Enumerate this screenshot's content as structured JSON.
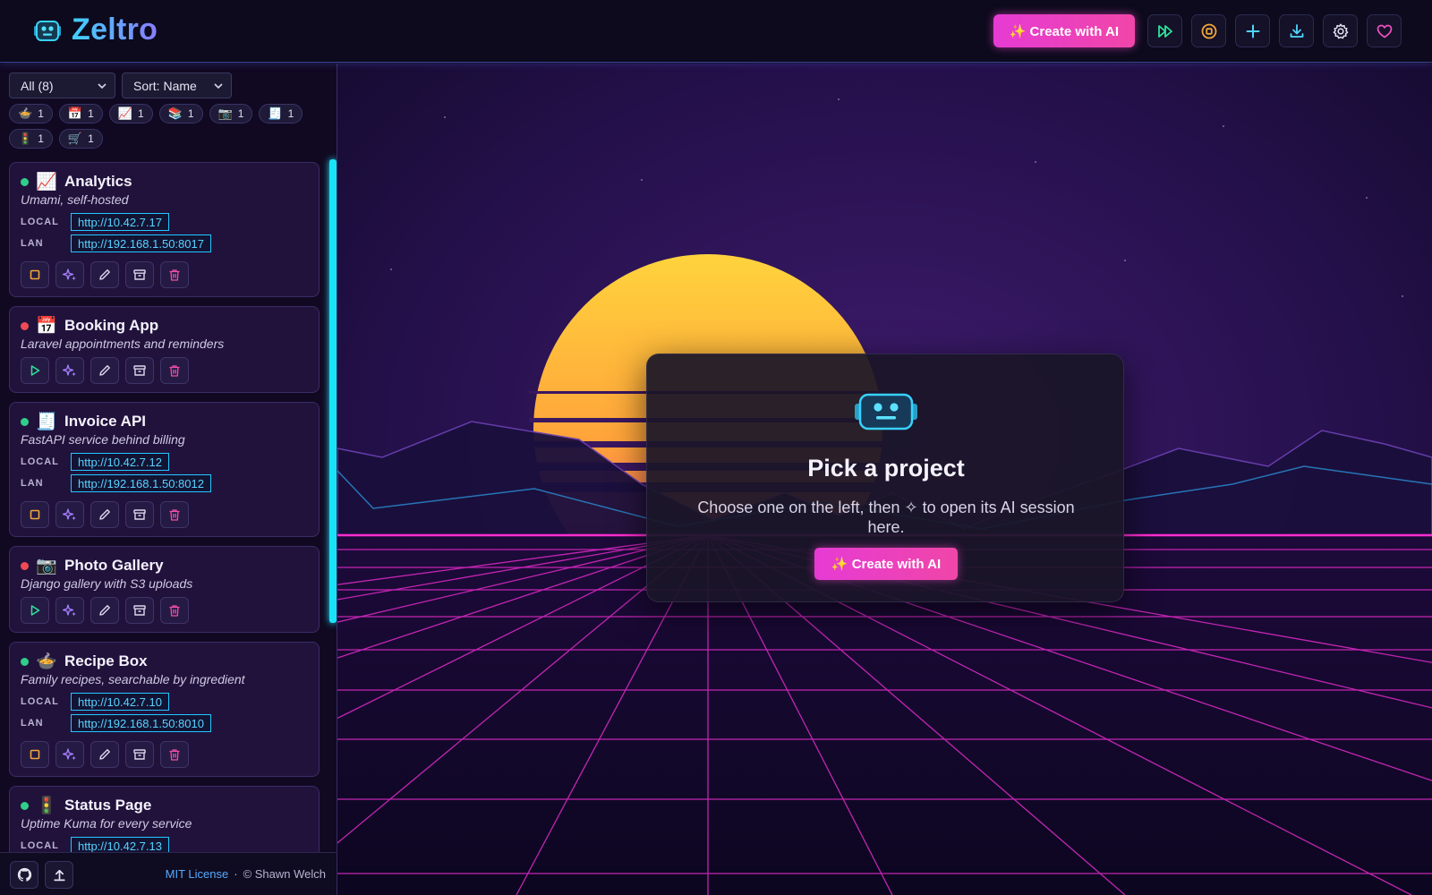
{
  "app": {
    "name": "Zeltro"
  },
  "header": {
    "create_label": "✨ Create with AI",
    "icons": [
      "fast-forward-icon",
      "stop-circle-icon",
      "plus-icon",
      "download-icon",
      "gear-icon",
      "heart-icon"
    ]
  },
  "sidebar": {
    "filter_value": "All (8)",
    "sort_value": "Sort: Name",
    "chips": [
      {
        "emoji": "🍲",
        "count": "1"
      },
      {
        "emoji": "📅",
        "count": "1"
      },
      {
        "emoji": "📈",
        "count": "1"
      },
      {
        "emoji": "📚",
        "count": "1"
      },
      {
        "emoji": "📷",
        "count": "1"
      },
      {
        "emoji": "🧾",
        "count": "1"
      },
      {
        "emoji": "🚦",
        "count": "1"
      },
      {
        "emoji": "🛒",
        "count": "1"
      }
    ],
    "local_label": "LOCAL",
    "lan_label": "LAN",
    "projects": [
      {
        "name": "Analytics",
        "emoji": "📈",
        "desc": "Umami, self-hosted",
        "running": true,
        "local": "http://10.42.7.17",
        "lan": "http://192.168.1.50:8017"
      },
      {
        "name": "Booking App",
        "emoji": "📅",
        "desc": "Laravel appointments and reminders",
        "running": false
      },
      {
        "name": "Invoice API",
        "emoji": "🧾",
        "desc": "FastAPI service behind billing",
        "running": true,
        "local": "http://10.42.7.12",
        "lan": "http://192.168.1.50:8012"
      },
      {
        "name": "Photo Gallery",
        "emoji": "📷",
        "desc": "Django gallery with S3 uploads",
        "running": false
      },
      {
        "name": "Recipe Box",
        "emoji": "🍲",
        "desc": "Family recipes, searchable by ingredient",
        "running": true,
        "local": "http://10.42.7.10",
        "lan": "http://192.168.1.50:8010"
      },
      {
        "name": "Status Page",
        "emoji": "🚦",
        "desc": "Uptime Kuma for every service",
        "running": true,
        "local": "http://10.42.7.13"
      }
    ],
    "footer": {
      "license": "MIT License",
      "separator": "·",
      "copyright": "© Shawn Welch"
    }
  },
  "modal": {
    "title": "Pick a project",
    "text": "Choose one on the left, then ✧ to open its AI session here.",
    "button": "✨ Create with AI"
  },
  "colors": {
    "accent_pink": "#f046a8",
    "accent_cyan": "#19e3f6",
    "status_running": "#2fcf8a",
    "status_stopped": "#ef4a55"
  }
}
